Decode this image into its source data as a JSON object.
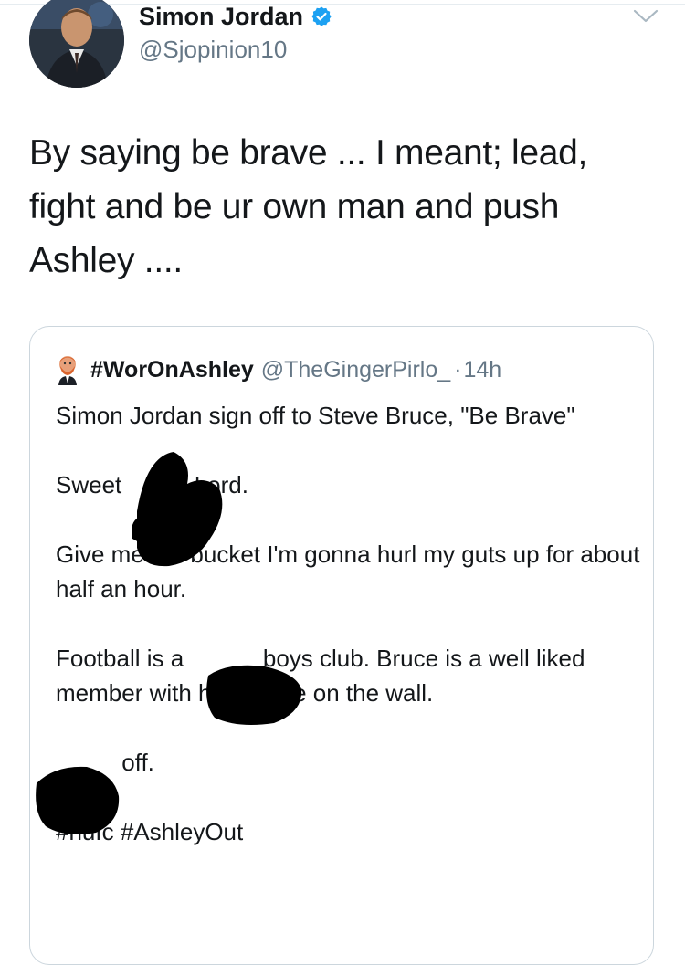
{
  "tweet": {
    "author": {
      "display_name": "Simon Jordan",
      "handle": "@Sjopinion10",
      "verified_icon": "verified-badge-icon"
    },
    "text_lines": [
      "By saying be brave ... I meant; lead,",
      "fight and be ur own man and push",
      "Ashley ...."
    ]
  },
  "quote": {
    "name": "#WorOnAshley",
    "handle": "@TheGingerPirlo_",
    "separator": "·",
    "time": "14h",
    "paragraphs": [
      "Simon Jordan sign off to Steve Bruce, \"Be Brave\"",
      "Sweet           Lord.",
      "Give me the bucket I'm gonna hurl my guts up for about half an hour.",
      "Football is a            boys club. Bruce is a well liked member with his picture on the wall.",
      "          off.",
      "#nufc #AshleyOut"
    ]
  },
  "colors": {
    "text": "#14171a",
    "secondary": "#657786",
    "border": "#ccd6dd",
    "verified": "#1da1f2"
  }
}
